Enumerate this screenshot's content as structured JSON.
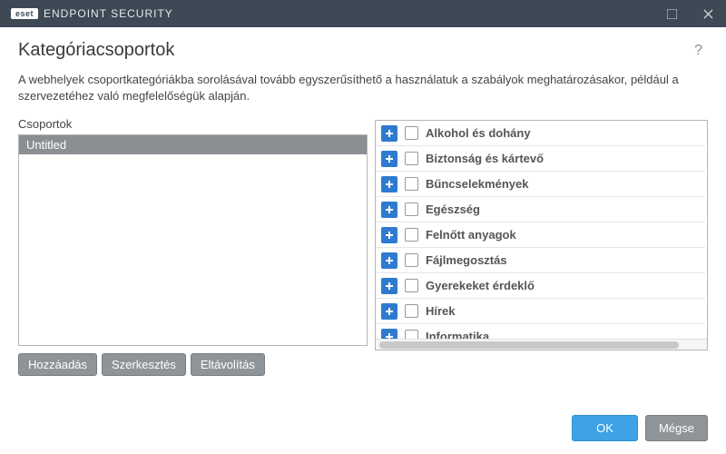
{
  "titlebar": {
    "brand_badge": "eset",
    "brand_text": "ENDPOINT SECURITY"
  },
  "page": {
    "title": "Kategóriacsoportok",
    "help": "?",
    "description": "A webhelyek csoportkategóriákba sorolásával tovább egyszerűsíthető a használatuk a szabályok meghatározásakor, például a szervezetéhez való megfelelőségük alapján."
  },
  "groups": {
    "label": "Csoportok",
    "items": [
      "Untitled"
    ],
    "buttons": {
      "add": "Hozzáadás",
      "edit": "Szerkesztés",
      "remove": "Eltávolítás"
    }
  },
  "categories": [
    "Alkohol és dohány",
    "Biztonság és kártevő",
    "Bűncselekmények",
    "Egészség",
    "Felnőtt anyagok",
    "Fájlmegosztás",
    "Gyerekeket érdeklő",
    "Hírek",
    "Informatika"
  ],
  "footer": {
    "ok": "OK",
    "cancel": "Mégse"
  }
}
